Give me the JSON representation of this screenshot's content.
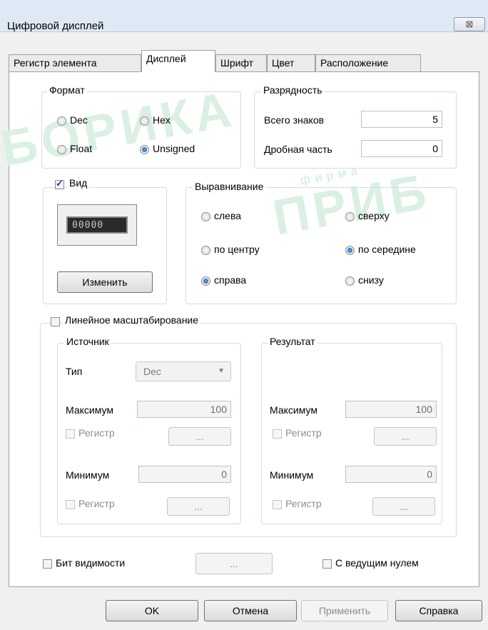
{
  "window": {
    "title": "Цифровой дисплей",
    "close_label": "⊠"
  },
  "tabs": [
    {
      "label": "Регистр элемента"
    },
    {
      "label": "Дисплей"
    },
    {
      "label": "Шрифт"
    },
    {
      "label": "Цвет"
    },
    {
      "label": "Расположение"
    }
  ],
  "format": {
    "legend": "Формат",
    "options": [
      {
        "label": "Dec",
        "checked": false
      },
      {
        "label": "Hex",
        "checked": false
      },
      {
        "label": "Float",
        "checked": false
      },
      {
        "label": "Unsigned",
        "checked": true
      }
    ]
  },
  "digits": {
    "legend": "Разрядность",
    "total_label": "Всего знаков",
    "total_value": "5",
    "fraction_label": "Дробная часть",
    "fraction_value": "0"
  },
  "view": {
    "label": "Вид",
    "checked": true,
    "preview_digits": "00000",
    "change_button": "Изменить"
  },
  "alignment": {
    "legend": "Выравнивание",
    "left": "слева",
    "center": "по центру",
    "right": "справа",
    "top": "сверху",
    "middle": "по середине",
    "bottom": "снизу"
  },
  "scaling": {
    "label": "Линейное масштабирование",
    "checked": false,
    "source": {
      "legend": "Источник",
      "type_label": "Тип",
      "type_value": "Dec",
      "max_label": "Максимум",
      "max_value": "100",
      "register_label": "Регистр",
      "min_label": "Минимум",
      "min_value": "0",
      "register2_label": "Регистр",
      "dots": "..."
    },
    "result": {
      "legend": "Результат",
      "max_label": "Максимум",
      "max_value": "100",
      "register_label": "Регистр",
      "min_label": "Минимум",
      "min_value": "0",
      "register2_label": "Регистр",
      "dots": "..."
    }
  },
  "visibility_bit": {
    "label": "Бит видимости",
    "dots": "..."
  },
  "leading_zero": {
    "label": "С ведущим нулем"
  },
  "buttons": {
    "ok": "OK",
    "cancel": "Отмена",
    "apply": "Применить",
    "help": "Справка"
  },
  "watermark": {
    "brand": "БОРИКА",
    "sub": "фирма",
    "brand2": "ПРИБ"
  },
  "colors": {
    "accent": "#1c5fb0",
    "watermark": "#d9f0e2",
    "background": "#f0f0f0"
  }
}
